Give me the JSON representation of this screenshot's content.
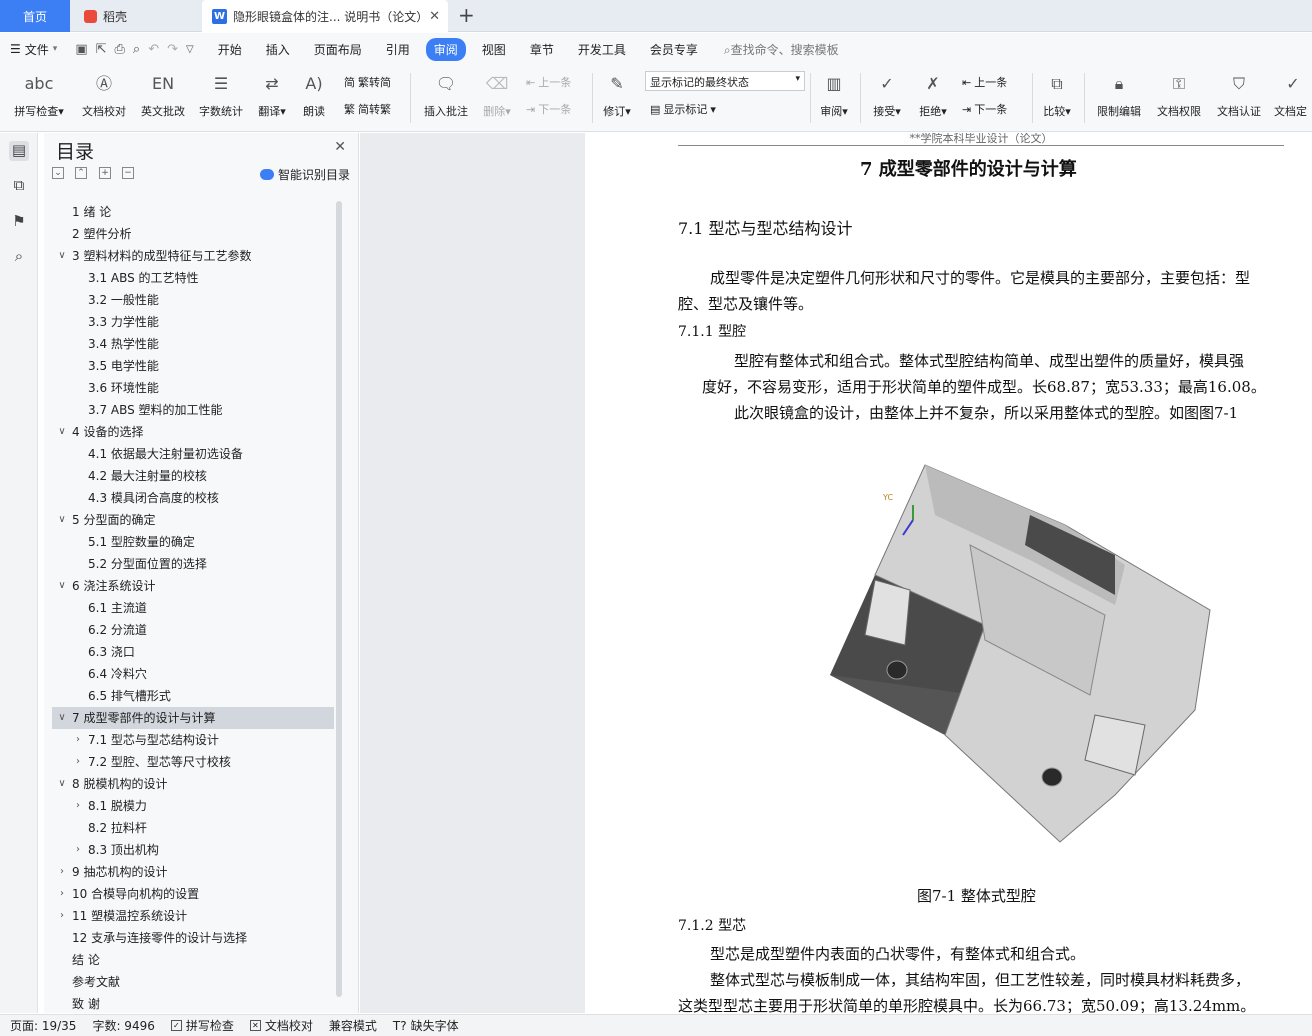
{
  "titlebar": {
    "home_tab": "首页",
    "docer_tab": "稻壳",
    "doc_tab": "隐形眼镜盒体的注... 说明书（论文）",
    "add_tab": "+"
  },
  "menubar": {
    "file": "文件",
    "items": [
      "开始",
      "插入",
      "页面布局",
      "引用",
      "审阅",
      "视图",
      "章节",
      "开发工具",
      "会员专享"
    ],
    "active": "审阅",
    "search_placeholder": "查找命令、搜索模板"
  },
  "ribbon": {
    "spell_check": "拼写检查",
    "doc_proof": "文档校对",
    "english_review": "英文批改",
    "word_count": "字数统计",
    "translate": "翻译",
    "read_aloud": "朗读",
    "trad_convert": "繁转简",
    "simp_convert": "简转繁",
    "insert_comment": "插入批注",
    "delete": "删除",
    "prev": "上一条",
    "next": "下一条",
    "revise": "修订",
    "markup_state": "显示标记的最终状态",
    "show_markup": "显示标记",
    "review": "审阅",
    "accept": "接受",
    "reject": "拒绝",
    "prev2": "上一条",
    "next2": "下一条",
    "compare": "比较",
    "restrict_edit": "限制编辑",
    "doc_permission": "文档权限",
    "doc_cert": "文档认证",
    "doc_finalize": "文档定"
  },
  "toc": {
    "title": "目录",
    "smart": "智能识别目录",
    "items": [
      {
        "label": "1  绪  论",
        "level": 1,
        "arrow": ""
      },
      {
        "label": "2  塑件分析",
        "level": 1,
        "arrow": ""
      },
      {
        "label": "3  塑料材料的成型特征与工艺参数",
        "level": 1,
        "arrow": "v"
      },
      {
        "label": "3.1 ABS 的工艺特性",
        "level": 2,
        "arrow": ""
      },
      {
        "label": "3.2  一般性能",
        "level": 2,
        "arrow": ""
      },
      {
        "label": "3.3  力学性能",
        "level": 2,
        "arrow": ""
      },
      {
        "label": "3.4  热学性能",
        "level": 2,
        "arrow": ""
      },
      {
        "label": "3.5  电学性能",
        "level": 2,
        "arrow": ""
      },
      {
        "label": "3.6  环境性能",
        "level": 2,
        "arrow": ""
      },
      {
        "label": "3.7 ABS 塑料的加工性能",
        "level": 2,
        "arrow": ""
      },
      {
        "label": "4  设备的选择",
        "level": 1,
        "arrow": "v"
      },
      {
        "label": "4.1  依据最大注射量初选设备",
        "level": 2,
        "arrow": ""
      },
      {
        "label": "4.2  最大注射量的校核",
        "level": 2,
        "arrow": ""
      },
      {
        "label": "4.3  模具闭合高度的校核",
        "level": 2,
        "arrow": ""
      },
      {
        "label": "5  分型面的确定",
        "level": 1,
        "arrow": "v"
      },
      {
        "label": "5.1  型腔数量的确定",
        "level": 2,
        "arrow": ""
      },
      {
        "label": "5.2  分型面位置的选择",
        "level": 2,
        "arrow": ""
      },
      {
        "label": "6  浇注系统设计",
        "level": 1,
        "arrow": "v"
      },
      {
        "label": "6.1  主流道",
        "level": 2,
        "arrow": ""
      },
      {
        "label": "6.2  分流道",
        "level": 2,
        "arrow": ""
      },
      {
        "label": "6.3  浇口",
        "level": 2,
        "arrow": ""
      },
      {
        "label": "6.4  冷料穴",
        "level": 2,
        "arrow": ""
      },
      {
        "label": "6.5  排气槽形式",
        "level": 2,
        "arrow": ""
      },
      {
        "label": "7  成型零部件的设计与计算",
        "level": 1,
        "arrow": "v",
        "selected": true
      },
      {
        "label": "7.1  型芯与型芯结构设计",
        "level": 2,
        "arrow": ">"
      },
      {
        "label": "7.2  型腔、型芯等尺寸校核",
        "level": 2,
        "arrow": ">"
      },
      {
        "label": "8  脱模机构的设计",
        "level": 1,
        "arrow": "v"
      },
      {
        "label": "8.1  脱模力",
        "level": 2,
        "arrow": ">"
      },
      {
        "label": "8.2  拉料杆",
        "level": 2,
        "arrow": ""
      },
      {
        "label": "8.3  顶出机构",
        "level": 2,
        "arrow": ">"
      },
      {
        "label": "9  抽芯机构的设计",
        "level": 1,
        "arrow": ">"
      },
      {
        "label": "10  合模导向机构的设置",
        "level": 1,
        "arrow": ">"
      },
      {
        "label": "11  塑模温控系统设计",
        "level": 1,
        "arrow": ">"
      },
      {
        "label": "12  支承与连接零件的设计与选择",
        "level": 1,
        "arrow": ""
      },
      {
        "label": "结  论",
        "level": 1,
        "arrow": ""
      },
      {
        "label": "参考文献",
        "level": 1,
        "arrow": ""
      },
      {
        "label": "致  谢",
        "level": 1,
        "arrow": ""
      }
    ]
  },
  "document": {
    "header": "**学院本科毕业设计（论文）",
    "chapter_title": "7  成型零部件的设计与计算",
    "section_title": "7.1  型芯与型芯结构设计",
    "para1_line1": "成型零件是决定塑件几何形状和尺寸的零件。它是模具的主要部分，主要包括：型",
    "para1_line2": "腔、型芯及镶件等。",
    "sub1": "7.1.1  型腔",
    "para2_line1": "型腔有整体式和组合式。整体式型腔结构简单、成型出塑件的质量好，模具强",
    "para2_line2": "度好，不容易变形，适用于形状简单的塑件成型。长68.87；宽53.33；最高16.08。",
    "para3": "此次眼镜盒的设计，由整体上并不复杂，所以采用整体式的型腔。如图图7-1",
    "axis_label": "YC",
    "figure_caption": "图7-1  整体式型腔",
    "sub2": "7.1.2  型芯",
    "para4": "型芯是成型塑件内表面的凸状零件，有整体式和组合式。",
    "para5_line1": "整体式型芯与模板制成一体，其结构牢固，但工艺性较差，同时模具材料耗费多，",
    "para5_line2": "这类型型芯主要用于形状简单的单形腔模具中。长为66.73；宽50.09；高13.24mm。"
  },
  "statusbar": {
    "page": "页面: 19/35",
    "words": "字数: 9496",
    "spell": "拼写检查",
    "proof": "文档校对",
    "compat": "兼容模式",
    "missing_font": "缺失字体"
  }
}
